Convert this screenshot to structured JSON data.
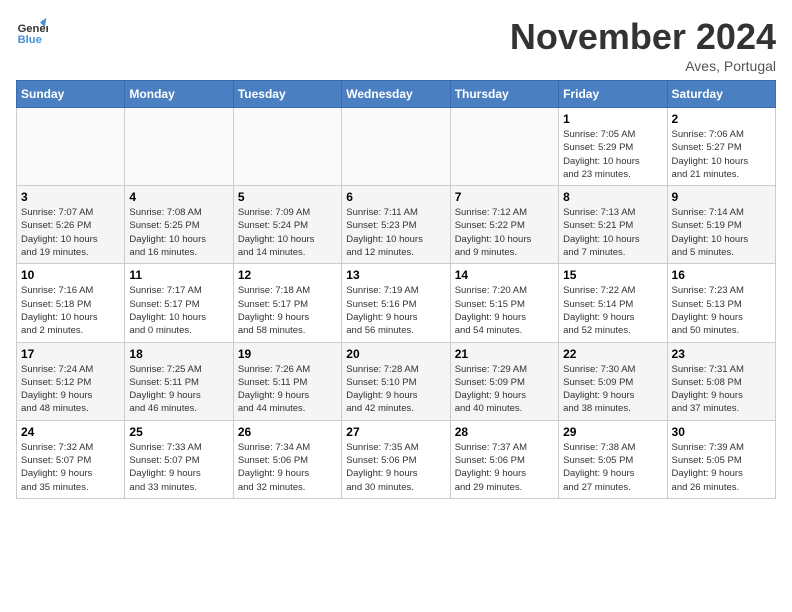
{
  "header": {
    "logo_line1": "General",
    "logo_line2": "Blue",
    "month": "November 2024",
    "location": "Aves, Portugal"
  },
  "days_of_week": [
    "Sunday",
    "Monday",
    "Tuesday",
    "Wednesday",
    "Thursday",
    "Friday",
    "Saturday"
  ],
  "weeks": [
    [
      {
        "day": "",
        "info": ""
      },
      {
        "day": "",
        "info": ""
      },
      {
        "day": "",
        "info": ""
      },
      {
        "day": "",
        "info": ""
      },
      {
        "day": "",
        "info": ""
      },
      {
        "day": "1",
        "info": "Sunrise: 7:05 AM\nSunset: 5:29 PM\nDaylight: 10 hours\nand 23 minutes."
      },
      {
        "day": "2",
        "info": "Sunrise: 7:06 AM\nSunset: 5:27 PM\nDaylight: 10 hours\nand 21 minutes."
      }
    ],
    [
      {
        "day": "3",
        "info": "Sunrise: 7:07 AM\nSunset: 5:26 PM\nDaylight: 10 hours\nand 19 minutes."
      },
      {
        "day": "4",
        "info": "Sunrise: 7:08 AM\nSunset: 5:25 PM\nDaylight: 10 hours\nand 16 minutes."
      },
      {
        "day": "5",
        "info": "Sunrise: 7:09 AM\nSunset: 5:24 PM\nDaylight: 10 hours\nand 14 minutes."
      },
      {
        "day": "6",
        "info": "Sunrise: 7:11 AM\nSunset: 5:23 PM\nDaylight: 10 hours\nand 12 minutes."
      },
      {
        "day": "7",
        "info": "Sunrise: 7:12 AM\nSunset: 5:22 PM\nDaylight: 10 hours\nand 9 minutes."
      },
      {
        "day": "8",
        "info": "Sunrise: 7:13 AM\nSunset: 5:21 PM\nDaylight: 10 hours\nand 7 minutes."
      },
      {
        "day": "9",
        "info": "Sunrise: 7:14 AM\nSunset: 5:19 PM\nDaylight: 10 hours\nand 5 minutes."
      }
    ],
    [
      {
        "day": "10",
        "info": "Sunrise: 7:16 AM\nSunset: 5:18 PM\nDaylight: 10 hours\nand 2 minutes."
      },
      {
        "day": "11",
        "info": "Sunrise: 7:17 AM\nSunset: 5:17 PM\nDaylight: 10 hours\nand 0 minutes."
      },
      {
        "day": "12",
        "info": "Sunrise: 7:18 AM\nSunset: 5:17 PM\nDaylight: 9 hours\nand 58 minutes."
      },
      {
        "day": "13",
        "info": "Sunrise: 7:19 AM\nSunset: 5:16 PM\nDaylight: 9 hours\nand 56 minutes."
      },
      {
        "day": "14",
        "info": "Sunrise: 7:20 AM\nSunset: 5:15 PM\nDaylight: 9 hours\nand 54 minutes."
      },
      {
        "day": "15",
        "info": "Sunrise: 7:22 AM\nSunset: 5:14 PM\nDaylight: 9 hours\nand 52 minutes."
      },
      {
        "day": "16",
        "info": "Sunrise: 7:23 AM\nSunset: 5:13 PM\nDaylight: 9 hours\nand 50 minutes."
      }
    ],
    [
      {
        "day": "17",
        "info": "Sunrise: 7:24 AM\nSunset: 5:12 PM\nDaylight: 9 hours\nand 48 minutes."
      },
      {
        "day": "18",
        "info": "Sunrise: 7:25 AM\nSunset: 5:11 PM\nDaylight: 9 hours\nand 46 minutes."
      },
      {
        "day": "19",
        "info": "Sunrise: 7:26 AM\nSunset: 5:11 PM\nDaylight: 9 hours\nand 44 minutes."
      },
      {
        "day": "20",
        "info": "Sunrise: 7:28 AM\nSunset: 5:10 PM\nDaylight: 9 hours\nand 42 minutes."
      },
      {
        "day": "21",
        "info": "Sunrise: 7:29 AM\nSunset: 5:09 PM\nDaylight: 9 hours\nand 40 minutes."
      },
      {
        "day": "22",
        "info": "Sunrise: 7:30 AM\nSunset: 5:09 PM\nDaylight: 9 hours\nand 38 minutes."
      },
      {
        "day": "23",
        "info": "Sunrise: 7:31 AM\nSunset: 5:08 PM\nDaylight: 9 hours\nand 37 minutes."
      }
    ],
    [
      {
        "day": "24",
        "info": "Sunrise: 7:32 AM\nSunset: 5:07 PM\nDaylight: 9 hours\nand 35 minutes."
      },
      {
        "day": "25",
        "info": "Sunrise: 7:33 AM\nSunset: 5:07 PM\nDaylight: 9 hours\nand 33 minutes."
      },
      {
        "day": "26",
        "info": "Sunrise: 7:34 AM\nSunset: 5:06 PM\nDaylight: 9 hours\nand 32 minutes."
      },
      {
        "day": "27",
        "info": "Sunrise: 7:35 AM\nSunset: 5:06 PM\nDaylight: 9 hours\nand 30 minutes."
      },
      {
        "day": "28",
        "info": "Sunrise: 7:37 AM\nSunset: 5:06 PM\nDaylight: 9 hours\nand 29 minutes."
      },
      {
        "day": "29",
        "info": "Sunrise: 7:38 AM\nSunset: 5:05 PM\nDaylight: 9 hours\nand 27 minutes."
      },
      {
        "day": "30",
        "info": "Sunrise: 7:39 AM\nSunset: 5:05 PM\nDaylight: 9 hours\nand 26 minutes."
      }
    ]
  ]
}
